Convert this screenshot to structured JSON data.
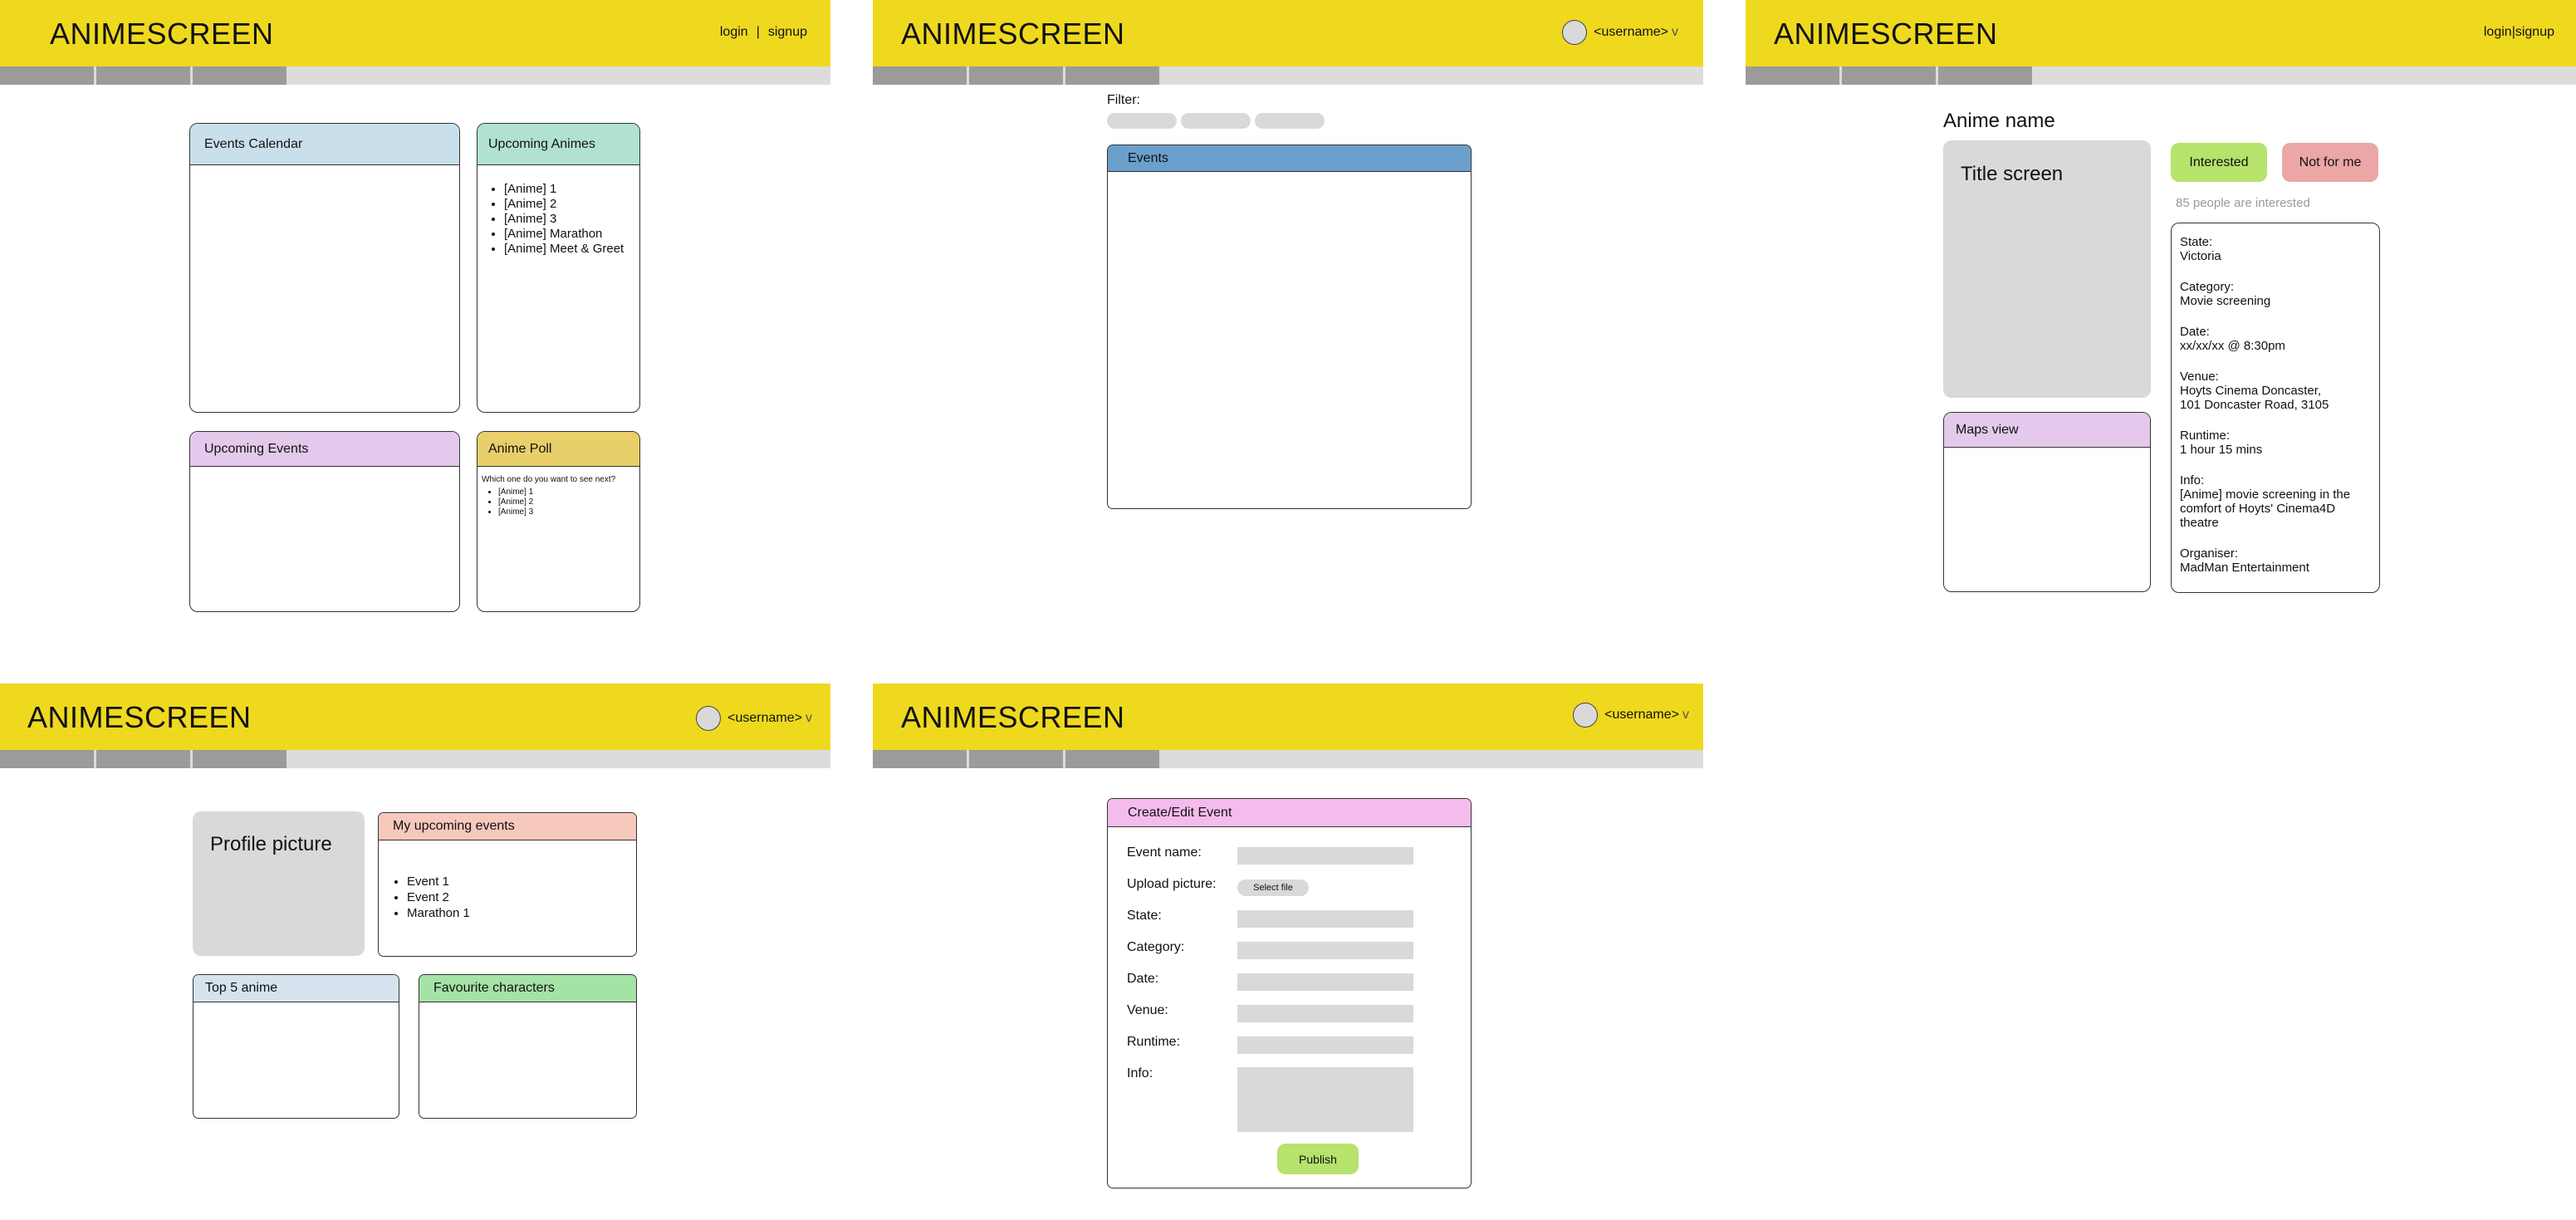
{
  "app": {
    "logo": "ANIMESCREEN"
  },
  "auth": {
    "login": "login",
    "sep": "|",
    "signup": "signup"
  },
  "user": {
    "name": "<username>",
    "caret": "v"
  },
  "home": {
    "events_calendar": "Events Calendar",
    "upcoming_animes": "Upcoming Animes",
    "upcoming_animes_items": [
      "[Anime] 1",
      "[Anime] 2",
      "[Anime] 3",
      "[Anime] Marathon",
      "[Anime] Meet & Greet"
    ],
    "upcoming_events": "Upcoming Events",
    "anime_poll": "Anime Poll",
    "poll_question": "Which one do you want to see next?",
    "poll_options": [
      "[Anime] 1",
      "[Anime] 2",
      "[Anime] 3"
    ]
  },
  "events_page": {
    "filter_label": "Filter:",
    "events_title": "Events"
  },
  "detail": {
    "anime_name": "Anime name",
    "title_screen": "Title screen",
    "interested": "Interested",
    "not_for_me": "Not for me",
    "interested_count": "85 people are interested",
    "maps_view": "Maps view",
    "state_label": "State:",
    "state_value": "Victoria",
    "category_label": "Category:",
    "category_value": "Movie screening",
    "date_label": "Date:",
    "date_value": "xx/xx/xx @ 8:30pm",
    "venue_label": "Venue:",
    "venue_line1": "Hoyts Cinema Doncaster,",
    "venue_line2": "101 Doncaster Road, 3105",
    "runtime_label": "Runtime:",
    "runtime_value": "1 hour 15 mins",
    "info_label": "Info:",
    "info_line1": "[Anime] movie screening in the",
    "info_line2": "comfort of Hoyts' Cinema4D",
    "info_line3": "theatre",
    "organiser_label": "Organiser:",
    "organiser_value": "MadMan Entertainment"
  },
  "profile": {
    "profile_picture": "Profile picture",
    "my_upcoming_events": "My upcoming events",
    "my_events_items": [
      "Event 1",
      "Event 2",
      "Marathon 1"
    ],
    "top5": "Top 5 anime",
    "favourite_characters": "Favourite characters"
  },
  "create": {
    "title": "Create/Edit Event",
    "event_name": "Event name:",
    "upload_picture": "Upload picture:",
    "select_file": "Select file",
    "state": "State:",
    "category": "Category:",
    "date": "Date:",
    "venue": "Venue:",
    "runtime": "Runtime:",
    "info": "Info:",
    "publish": "Publish"
  },
  "colors": {
    "header": "#efd91e",
    "calendar_head": "#c9dfeb",
    "animes_head": "#b1e2cf",
    "events_head": "#e4c9ec",
    "poll_head": "#e9cf6a",
    "events_blue": "#6b9fcc",
    "maps_head": "#e4c9ec",
    "interested": "#b5e36b",
    "not_for_me": "#eba6a6",
    "my_events_head": "#f6c9bc",
    "top5_head": "#d6e3ef",
    "fav_head": "#a5e2a6",
    "create_head": "#f4bced",
    "publish": "#b5e36b"
  }
}
